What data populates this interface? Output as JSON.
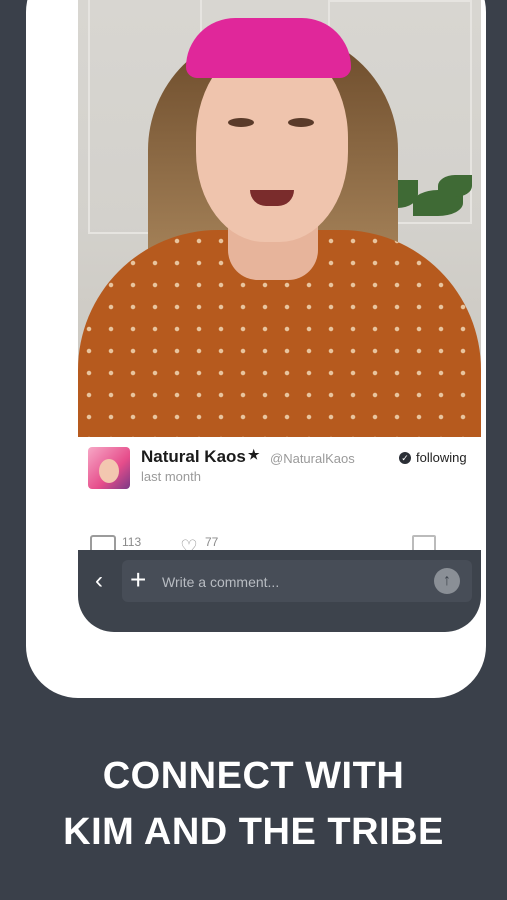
{
  "post": {
    "author": "Natural Kaos",
    "star": "★",
    "handle": "@NaturalKaos",
    "timestamp": "last month",
    "follow_status": "following",
    "comment_count": "113",
    "like_count": "77"
  },
  "comment_bar": {
    "placeholder": "Write a comment...",
    "back_glyph": "‹",
    "plus_glyph": "+",
    "send_glyph": "↑"
  },
  "caption": {
    "line1": "CONNECT WITH",
    "line2": "KIM AND THE TRIBE"
  },
  "colors": {
    "background": "#3a404a",
    "headband": "#e0279a",
    "sweater": "#b65a1e",
    "comment_bar": "#3d434c"
  }
}
